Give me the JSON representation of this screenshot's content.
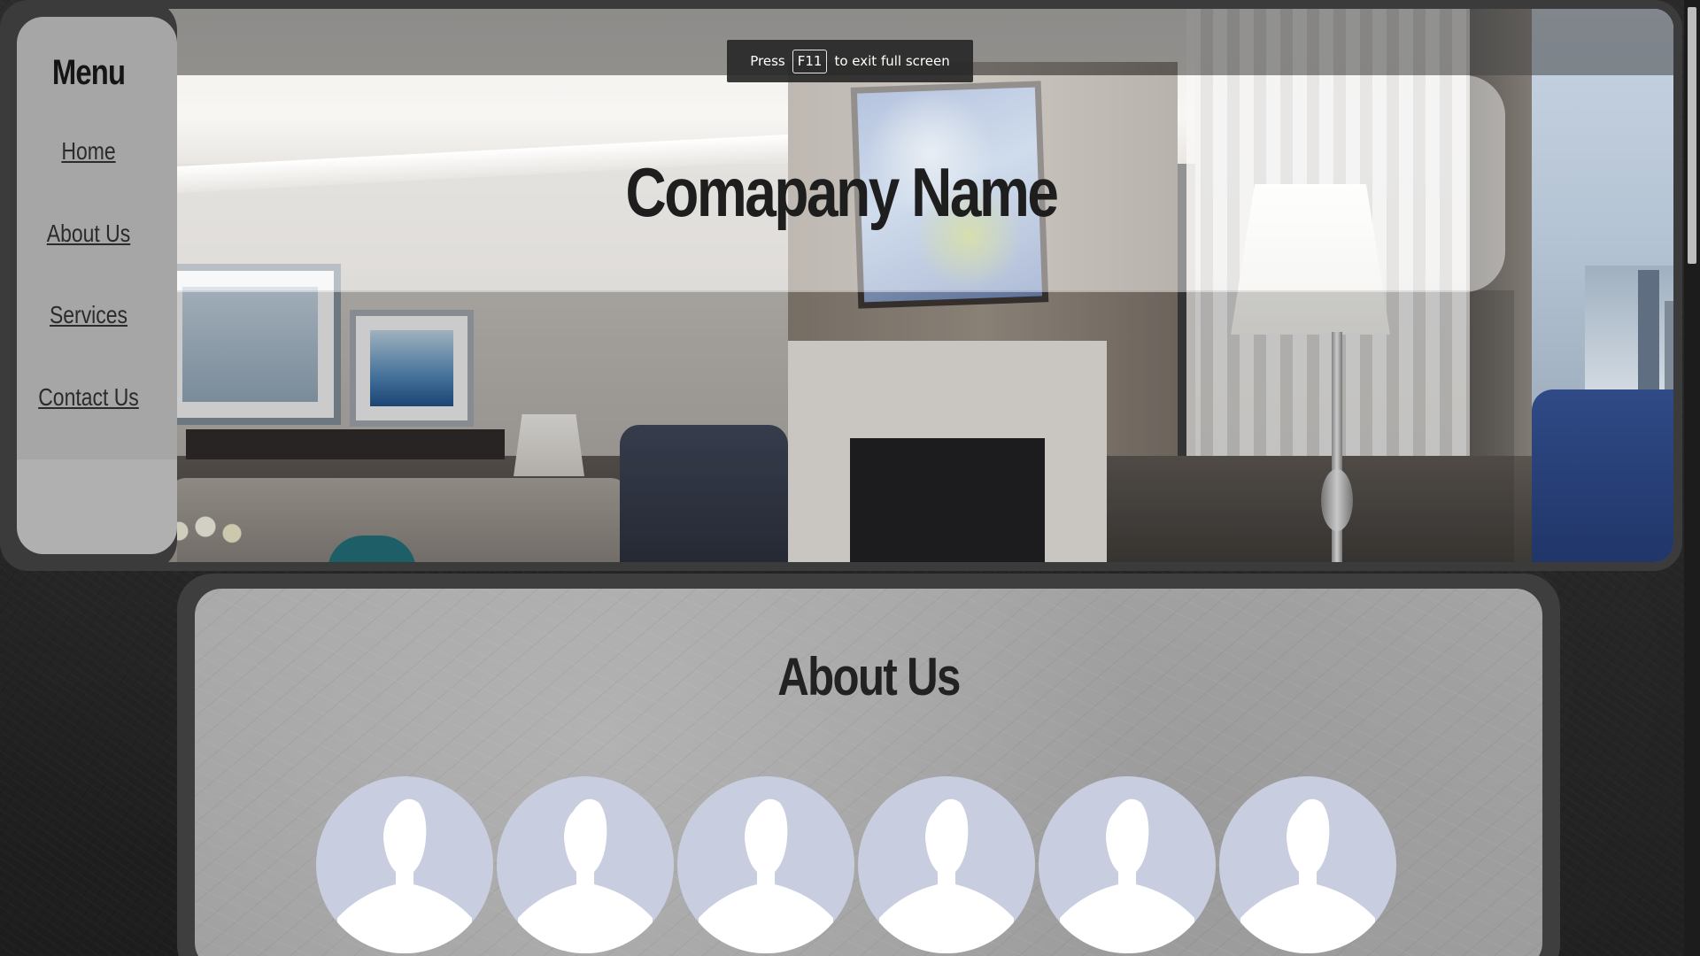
{
  "fullscreen_toast": {
    "press": "Press",
    "key": "F11",
    "suffix": "to exit full screen"
  },
  "hero": {
    "company_name": "Comapany Name"
  },
  "sidebar": {
    "title": "Menu",
    "items": [
      {
        "label": "Home"
      },
      {
        "label": "About Us"
      },
      {
        "label": "Services"
      },
      {
        "label": "Contact Us"
      }
    ]
  },
  "about": {
    "title": "About Us",
    "team_members": [
      {
        "icon": "person-silhouette-icon"
      },
      {
        "icon": "person-silhouette-icon"
      },
      {
        "icon": "person-silhouette-icon"
      },
      {
        "icon": "person-silhouette-icon"
      },
      {
        "icon": "person-silhouette-icon"
      },
      {
        "icon": "person-silhouette-icon"
      }
    ]
  },
  "colors": {
    "avatar_bg": "#c8cde0",
    "panel_dark": "#3b3b3b"
  }
}
